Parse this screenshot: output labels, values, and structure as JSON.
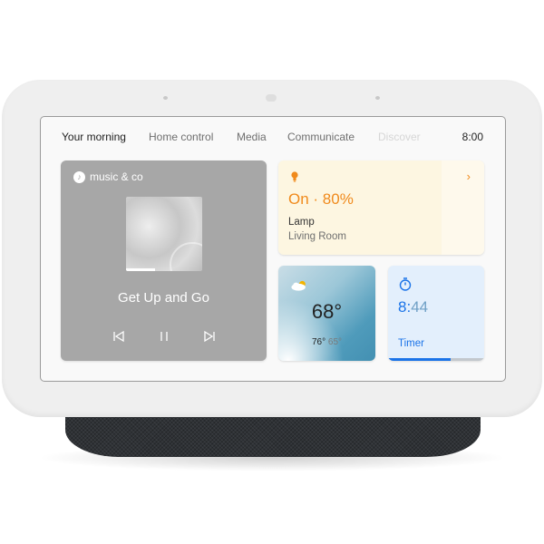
{
  "device": {
    "name": "Nest Hub"
  },
  "tabs": [
    {
      "label": "Your morning",
      "state": "active"
    },
    {
      "label": "Home control",
      "state": "normal"
    },
    {
      "label": "Media",
      "state": "normal"
    },
    {
      "label": "Communicate",
      "state": "normal"
    },
    {
      "label": "Discover",
      "state": "faded"
    }
  ],
  "clock": "8:00",
  "media": {
    "source_icon": "music-note-icon",
    "source": "music & co",
    "song": "Get Up and Go",
    "controls": [
      "previous-icon",
      "pause-icon",
      "next-icon"
    ],
    "progress": 0.38
  },
  "lamp": {
    "icon": "lightbulb-icon",
    "state": "On · 80%",
    "name": "Lamp",
    "room": "Living Room",
    "accent": "#f08a1c",
    "chevron": "›"
  },
  "weather": {
    "icon": "partly-cloudy-icon",
    "temp": "68°",
    "high": "76°",
    "low": "65°"
  },
  "timer": {
    "icon": "stopwatch-icon",
    "minutes": "8",
    "sep": ":",
    "seconds": "44",
    "label": "Timer",
    "progress": 0.65,
    "accent": "#1a73e8"
  }
}
